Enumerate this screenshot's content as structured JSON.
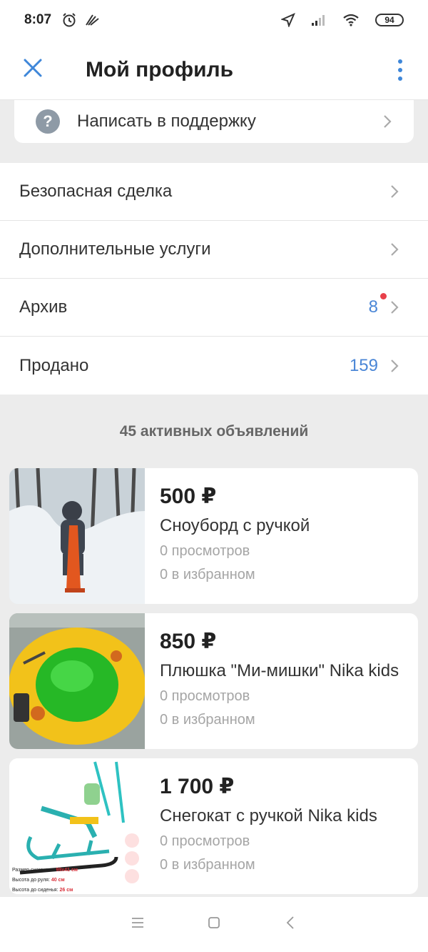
{
  "status_bar": {
    "time": "8:07",
    "battery": "94"
  },
  "header": {
    "title": "Мой профиль",
    "close_icon": "close-icon",
    "more_icon": "more-vertical-icon"
  },
  "support": {
    "label": "Написать в поддержку",
    "icon": "question-icon"
  },
  "menu": {
    "items": [
      {
        "label": "Безопасная сделка",
        "count": ""
      },
      {
        "label": "Дополнительные услуги",
        "count": ""
      },
      {
        "label": "Архив",
        "count": "8"
      },
      {
        "label": "Продано",
        "count": "159"
      }
    ]
  },
  "listings": {
    "header": "45 активных объявлений",
    "items": [
      {
        "price": "500 ₽",
        "title": "Сноуборд с ручкой",
        "views": "0 просмотров",
        "favorites": "0 в избранном"
      },
      {
        "price": "850 ₽",
        "title": "Плюшка \"Ми-мишки\" Nika kids",
        "views": "0 просмотров",
        "favorites": "0 в избранном"
      },
      {
        "price": "1 700 ₽",
        "title": "Снегокат с ручкой Nika kids",
        "views": "0 просмотров",
        "favorites": "0 в избранном"
      }
    ],
    "image_3_specs": [
      {
        "label": "Размер снегоката:",
        "value": "99x41 см"
      },
      {
        "label": "Высота до руля:",
        "value": "40 см"
      },
      {
        "label": "Высота до сиденья:",
        "value": "26 см"
      }
    ]
  },
  "colors": {
    "accent": "#4a86d6",
    "badge_dot": "#e8404a",
    "background": "#ececec"
  }
}
